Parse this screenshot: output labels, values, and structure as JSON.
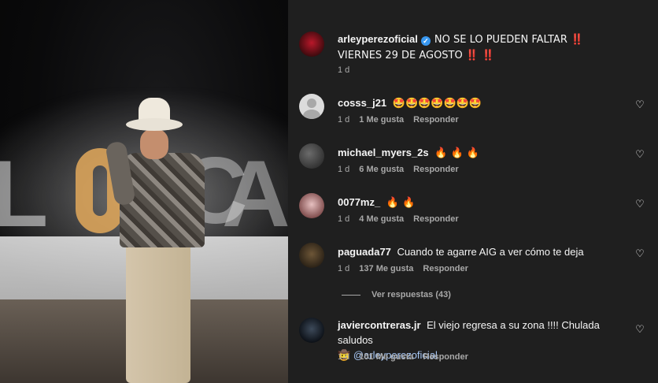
{
  "video": {
    "sign_letters": [
      "L",
      "C",
      "A"
    ]
  },
  "post": {
    "username": "arleyperezoficial",
    "verified": true,
    "caption_line1": "NO SE LO PUEDEN FALTAR ‼️",
    "caption_line2": "VIERNES 29 DE AGOSTO ‼️ ‼️",
    "time": "1 d"
  },
  "comments": [
    {
      "username": "cosss_j21",
      "text": "🤩🤩🤩🤩🤩🤩🤩",
      "time": "1 d",
      "likes": "1 Me gusta",
      "reply": "Responder",
      "avatar": "default-avatar"
    },
    {
      "username": "michael_myers_2s",
      "text": "🔥 🔥 🔥",
      "time": "1 d",
      "likes": "6 Me gusta",
      "reply": "Responder",
      "avatar": "dark"
    },
    {
      "username": "0077mz_",
      "text": "🔥 🔥",
      "time": "1 d",
      "likes": "4 Me gusta",
      "reply": "Responder",
      "avatar": "pink"
    },
    {
      "username": "paguada77",
      "text": "Cuando te agarre AIG a ver cómo te deja",
      "time": "1 d",
      "likes": "137 Me gusta",
      "reply": "Responder",
      "avatar": "brown",
      "view_replies": "Ver respuestas (43)"
    },
    {
      "username": "javiercontreras.jr",
      "text": "El viejo regresa a su zona !!!! Chulada saludos",
      "text_line2_emoji": "🤠",
      "mention": "@arleyperezoficial",
      "time": "1 d",
      "likes": "101 Me gusta",
      "reply": "Responder",
      "avatar": "navy"
    }
  ],
  "icons": {
    "heart": "♡",
    "verified": "✓"
  },
  "colors": {
    "panel_bg": "#1f1f1f",
    "text": "#f5f5f5",
    "muted": "#a8a8a8",
    "verified": "#3897f0",
    "mention": "#a7c7f5"
  }
}
